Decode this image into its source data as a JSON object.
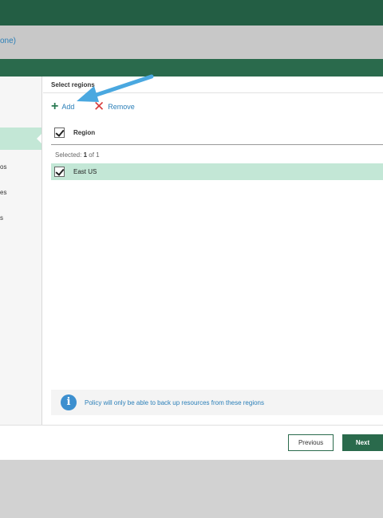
{
  "subbar": {
    "text": "one)"
  },
  "steps": [
    {
      "label": "",
      "active": true
    },
    {
      "label": "os",
      "active": false
    },
    {
      "label": "es",
      "active": false
    },
    {
      "label": "s",
      "active": false
    }
  ],
  "main": {
    "section_title": "Select regions",
    "toolbar": {
      "add_label": "Add",
      "remove_label": "Remove"
    },
    "table": {
      "column_header": "Region"
    },
    "selected": {
      "prefix": "Selected:",
      "count": "1",
      "suffix": "of 1"
    },
    "rows": [
      {
        "name": "East US",
        "checked": true
      }
    ],
    "info_text": "Policy will only be able to back up resources from these regions"
  },
  "footer": {
    "previous_label": "Previous",
    "next_label": "Next"
  },
  "icons": {
    "add": "plus-icon",
    "remove": "x-icon",
    "info": "info-icon",
    "check": "checkmark-icon"
  },
  "colors": {
    "brand_green": "#235e44",
    "header_green": "#2a6a4c",
    "selected_row": "#c3e7d6",
    "link_blue": "#2b7fb8",
    "annotation_arrow": "#4aa8e0"
  }
}
